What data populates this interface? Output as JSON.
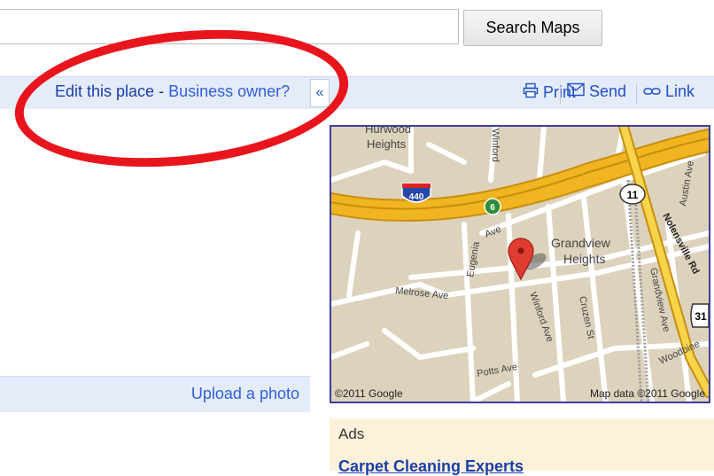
{
  "search": {
    "value": "",
    "button_label": "Search Maps"
  },
  "toolbar": {
    "edit_place": "Edit this place",
    "separator": " - ",
    "business_owner": "Business owner?",
    "collapse": "«",
    "print": "Print",
    "send": "Send",
    "link": "Link"
  },
  "map": {
    "labels": {
      "hurwood": "Hurwood",
      "heights": "Heights",
      "winford_top": "Winford",
      "interstate": "440",
      "route6": "6",
      "route11": "11",
      "route31": "31",
      "austin": "Austin Ave",
      "nolensville": "Nolensville Rd",
      "eugenia_ave": "Ave",
      "eugenia": "Eugenia",
      "grandview1": "Grandview",
      "grandview2": "Heights",
      "melrose": "Melrose Ave",
      "winford_ave": "Winford Ave",
      "cruzen": "Cruzen St",
      "grandview_ave": "Grandview Ave",
      "potts": "Potts Ave",
      "woodbine": "Woodbine"
    },
    "copyright": "©2011 Google",
    "map_data": "Map data ©2011 Google"
  },
  "photo": {
    "upload_label": "Upload a photo"
  },
  "ads": {
    "label": "Ads",
    "title": "Carpet Cleaning Experts"
  },
  "colors": {
    "link": "#2f5fdb",
    "bar": "#e5ecf9",
    "annotation": "#e8151d",
    "highway": "#f0b520",
    "ads_bg": "#fdf1d9"
  }
}
